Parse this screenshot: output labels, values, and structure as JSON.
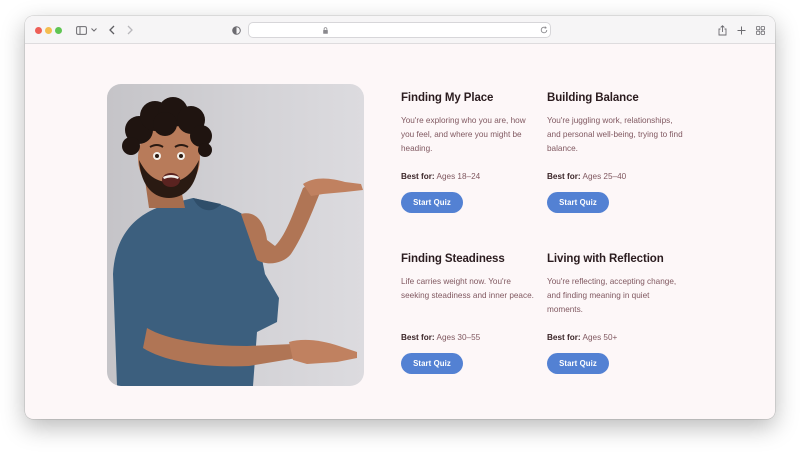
{
  "browser": {
    "colors": {
      "close": "#ee5f57",
      "minimize": "#f4bd4f",
      "zoom": "#5fc553"
    },
    "icons": [
      "sidebar-icon",
      "chevron-down-icon",
      "back-arrow-icon",
      "forward-arrow-icon",
      "shield-icon",
      "lock-icon",
      "reload-icon",
      "share-icon",
      "plus-icon",
      "tab-overview-icon"
    ]
  },
  "hero": {
    "image": "smiling man in blue t-shirt gesturing size with both hands"
  },
  "accent_color": "#5381d3",
  "cards": [
    {
      "title": "Finding My Place",
      "description": "You're exploring who you are, how you feel, and where you might be heading.",
      "best_for_label": "Best for:",
      "best_for_value": "Ages 18–24",
      "button_label": "Start Quiz"
    },
    {
      "title": "Building Balance",
      "description": "You're juggling work, relationships, and personal well-being, trying to find balance.",
      "best_for_label": "Best for:",
      "best_for_value": "Ages 25–40",
      "button_label": "Start Quiz"
    },
    {
      "title": "Finding Steadiness",
      "description": "Life carries weight now. You're seeking steadiness and inner peace.",
      "best_for_label": "Best for:",
      "best_for_value": "Ages 30–55",
      "button_label": "Start Quiz"
    },
    {
      "title": "Living with Reflection",
      "description": "You're reflecting, accepting change, and finding meaning in quiet moments.",
      "best_for_label": "Best for:",
      "best_for_value": "Ages 50+",
      "button_label": "Start Quiz"
    }
  ]
}
